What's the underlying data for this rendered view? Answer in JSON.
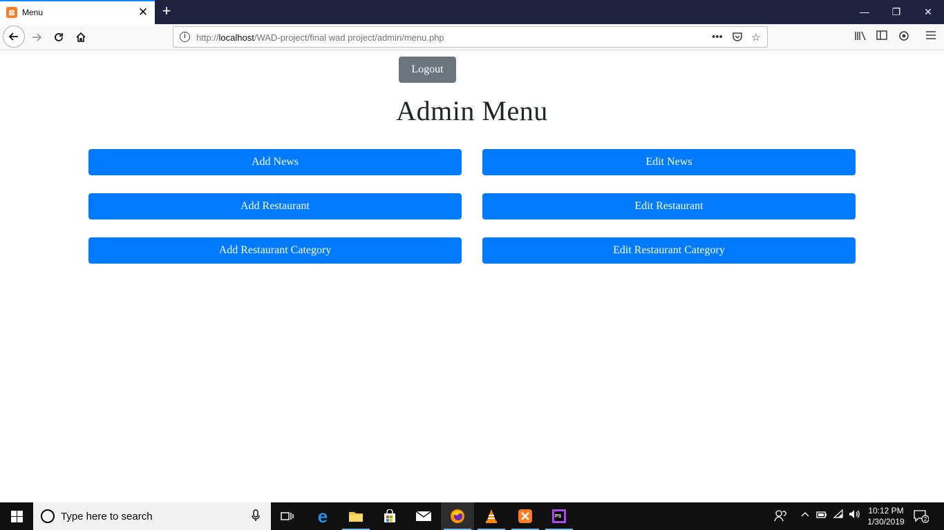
{
  "browser": {
    "tab_title": "Menu",
    "tab_favicon": "xampp-icon",
    "new_tab_label": "+",
    "url_prefix": "http://",
    "url_host": "localhost",
    "url_path": "/WAD-project/final wad project/admin/menu.php",
    "window_controls": [
      "minimize",
      "restore",
      "close"
    ],
    "accent_color": "#0a84ff"
  },
  "page": {
    "logout_label": "Logout",
    "title": "Admin Menu",
    "buttons": [
      {
        "label": "Add News"
      },
      {
        "label": "Edit News"
      },
      {
        "label": "Add Restaurant"
      },
      {
        "label": "Edit Restaurant"
      },
      {
        "label": "Add Restaurant Category"
      },
      {
        "label": "Edit Restaurant Category"
      }
    ],
    "primary_color": "#007bff",
    "secondary_color": "#6c757d"
  },
  "taskbar": {
    "search_placeholder": "Type here to search",
    "apps": [
      "task-view-icon",
      "edge-icon",
      "file-explorer-icon",
      "store-icon",
      "mail-icon",
      "firefox-icon",
      "vlc-icon",
      "xampp-icon",
      "phpstorm-icon"
    ],
    "active_app": "firefox-icon",
    "time": "10:12 PM",
    "date": "1/30/2019",
    "notification_count": "2"
  }
}
